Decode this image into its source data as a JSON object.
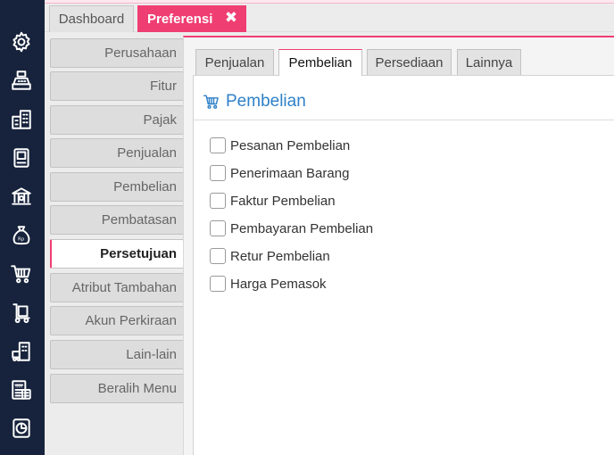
{
  "tabs": {
    "dashboard": "Dashboard",
    "preferensi": "Preferensi",
    "close_symbol": "✖"
  },
  "sidebar_icons": [
    "gear-icon",
    "cash-register-icon",
    "buildings-icon",
    "book-icon",
    "bank-icon",
    "money-bag-icon",
    "cart-icon",
    "hand-truck-icon",
    "store-icon",
    "tax-calculator-icon",
    "report-chart-icon"
  ],
  "menu": [
    "Perusahaan",
    "Fitur",
    "Pajak",
    "Penjualan",
    "Pembelian",
    "Pembatasan",
    "Persetujuan",
    "Atribut Tambahan",
    "Akun Perkiraan",
    "Lain-lain",
    "Beralih Menu"
  ],
  "menu_active": "Persetujuan",
  "inner_tabs": [
    "Penjualan",
    "Pembelian",
    "Persediaan",
    "Lainnya"
  ],
  "inner_tab_active": "Pembelian",
  "section": {
    "title": "Pembelian",
    "icon": "cart-icon",
    "options": [
      {
        "label": "Pesanan Pembelian",
        "checked": false
      },
      {
        "label": "Penerimaan Barang",
        "checked": false
      },
      {
        "label": "Faktur Pembelian",
        "checked": false
      },
      {
        "label": "Pembayaran Pembelian",
        "checked": false
      },
      {
        "label": "Retur Pembelian",
        "checked": false
      },
      {
        "label": "Harga Pemasok",
        "checked": false
      }
    ]
  },
  "colors": {
    "accent": "#ef3e72",
    "sidebar": "#17233c",
    "section_title": "#2f80c8"
  }
}
